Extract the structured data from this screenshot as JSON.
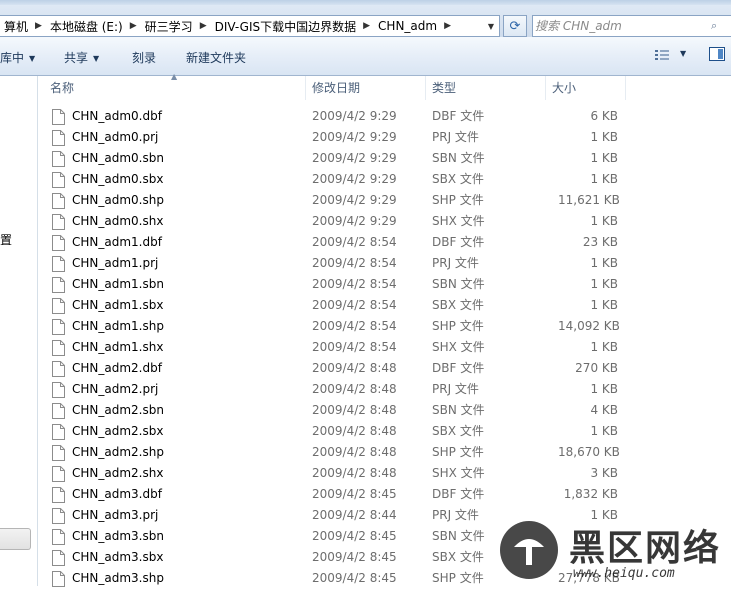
{
  "address": {
    "crumbs": [
      "算机",
      "本地磁盘 (E:)",
      "研三学习",
      "DIV-GIS下载中国边界数据",
      "CHN_adm"
    ]
  },
  "search": {
    "placeholder": "搜索 CHN_adm"
  },
  "toolbar": {
    "organize_label": "库中",
    "share_label": "共享",
    "burn_label": "刻录",
    "new_folder_label": "新建文件夹"
  },
  "nav": {
    "partial_label": "置"
  },
  "columns": {
    "name": "名称",
    "date": "修改日期",
    "type": "类型",
    "size": "大小"
  },
  "files": [
    {
      "name": "CHN_adm0.dbf",
      "date": "2009/4/2 9:29",
      "type": "DBF 文件",
      "size": "6 KB"
    },
    {
      "name": "CHN_adm0.prj",
      "date": "2009/4/2 9:29",
      "type": "PRJ 文件",
      "size": "1 KB"
    },
    {
      "name": "CHN_adm0.sbn",
      "date": "2009/4/2 9:29",
      "type": "SBN 文件",
      "size": "1 KB"
    },
    {
      "name": "CHN_adm0.sbx",
      "date": "2009/4/2 9:29",
      "type": "SBX 文件",
      "size": "1 KB"
    },
    {
      "name": "CHN_adm0.shp",
      "date": "2009/4/2 9:29",
      "type": "SHP 文件",
      "size": "11,621 KB"
    },
    {
      "name": "CHN_adm0.shx",
      "date": "2009/4/2 9:29",
      "type": "SHX 文件",
      "size": "1 KB"
    },
    {
      "name": "CHN_adm1.dbf",
      "date": "2009/4/2 8:54",
      "type": "DBF 文件",
      "size": "23 KB"
    },
    {
      "name": "CHN_adm1.prj",
      "date": "2009/4/2 8:54",
      "type": "PRJ 文件",
      "size": "1 KB"
    },
    {
      "name": "CHN_adm1.sbn",
      "date": "2009/4/2 8:54",
      "type": "SBN 文件",
      "size": "1 KB"
    },
    {
      "name": "CHN_adm1.sbx",
      "date": "2009/4/2 8:54",
      "type": "SBX 文件",
      "size": "1 KB"
    },
    {
      "name": "CHN_adm1.shp",
      "date": "2009/4/2 8:54",
      "type": "SHP 文件",
      "size": "14,092 KB"
    },
    {
      "name": "CHN_adm1.shx",
      "date": "2009/4/2 8:54",
      "type": "SHX 文件",
      "size": "1 KB"
    },
    {
      "name": "CHN_adm2.dbf",
      "date": "2009/4/2 8:48",
      "type": "DBF 文件",
      "size": "270 KB"
    },
    {
      "name": "CHN_adm2.prj",
      "date": "2009/4/2 8:48",
      "type": "PRJ 文件",
      "size": "1 KB"
    },
    {
      "name": "CHN_adm2.sbn",
      "date": "2009/4/2 8:48",
      "type": "SBN 文件",
      "size": "4 KB"
    },
    {
      "name": "CHN_adm2.sbx",
      "date": "2009/4/2 8:48",
      "type": "SBX 文件",
      "size": "1 KB"
    },
    {
      "name": "CHN_adm2.shp",
      "date": "2009/4/2 8:48",
      "type": "SHP 文件",
      "size": "18,670 KB"
    },
    {
      "name": "CHN_adm2.shx",
      "date": "2009/4/2 8:48",
      "type": "SHX 文件",
      "size": "3 KB"
    },
    {
      "name": "CHN_adm3.dbf",
      "date": "2009/4/2 8:45",
      "type": "DBF 文件",
      "size": "1,832 KB"
    },
    {
      "name": "CHN_adm3.prj",
      "date": "2009/4/2 8:44",
      "type": "PRJ 文件",
      "size": "1 KB"
    },
    {
      "name": "CHN_adm3.sbn",
      "date": "2009/4/2 8:45",
      "type": "SBN 文件",
      "size": ""
    },
    {
      "name": "CHN_adm3.sbx",
      "date": "2009/4/2 8:45",
      "type": "SBX 文件",
      "size": ""
    },
    {
      "name": "CHN_adm3.shp",
      "date": "2009/4/2 8:45",
      "type": "SHP 文件",
      "size": "27,778 KB"
    }
  ],
  "watermark": {
    "title": "黑区网络",
    "url": "www.heiqu.com"
  },
  "icons": {
    "file": "document-icon",
    "refresh": "refresh-icon",
    "search": "search-icon",
    "view": "view-options-icon",
    "preview": "preview-pane-icon"
  }
}
